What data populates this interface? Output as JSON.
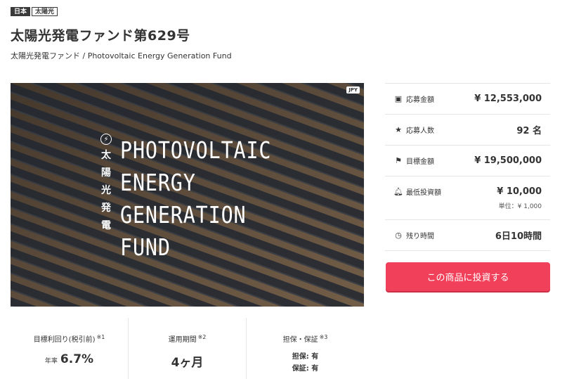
{
  "tags": [
    "日本",
    "太陽光"
  ],
  "title": "太陽光発電ファンド第629号",
  "subtitle": "太陽光発電ファンド / Photovoltaic Energy Generation Fund",
  "hero": {
    "badge": "JPY",
    "vertical_text": [
      "太",
      "陽",
      "光",
      "発",
      "電"
    ],
    "lines": [
      "PHOTOVOLTAIC",
      "ENERGY",
      "GENERATION",
      "FUND"
    ]
  },
  "info": {
    "amount_applied": {
      "label": "応募金額",
      "value": "¥ 12,553,000",
      "icon": "cash-icon"
    },
    "applicants": {
      "label": "応募人数",
      "value": "92 名",
      "icon": "star-icon"
    },
    "target": {
      "label": "目標金額",
      "value": "¥ 19,500,000",
      "icon": "flag-icon"
    },
    "min_invest": {
      "label": "最低投資額",
      "value": "¥ 10,000",
      "sub": "単位：¥ 1,000",
      "icon": "bell-icon"
    },
    "remaining": {
      "label": "残り時間",
      "value": "6日10時間",
      "icon": "clock-icon"
    }
  },
  "cta_label": "この商品に投資する",
  "stats": {
    "yield": {
      "label": "目標利回り(税引前)",
      "note": "※1",
      "prefix": "年率",
      "value": "6.7%"
    },
    "period": {
      "label": "運用期間",
      "note": "※2",
      "value": "4ヶ月"
    },
    "security": {
      "label": "担保・保証",
      "note": "※3",
      "line1": "担保: 有",
      "line2": "保証: 有"
    }
  }
}
